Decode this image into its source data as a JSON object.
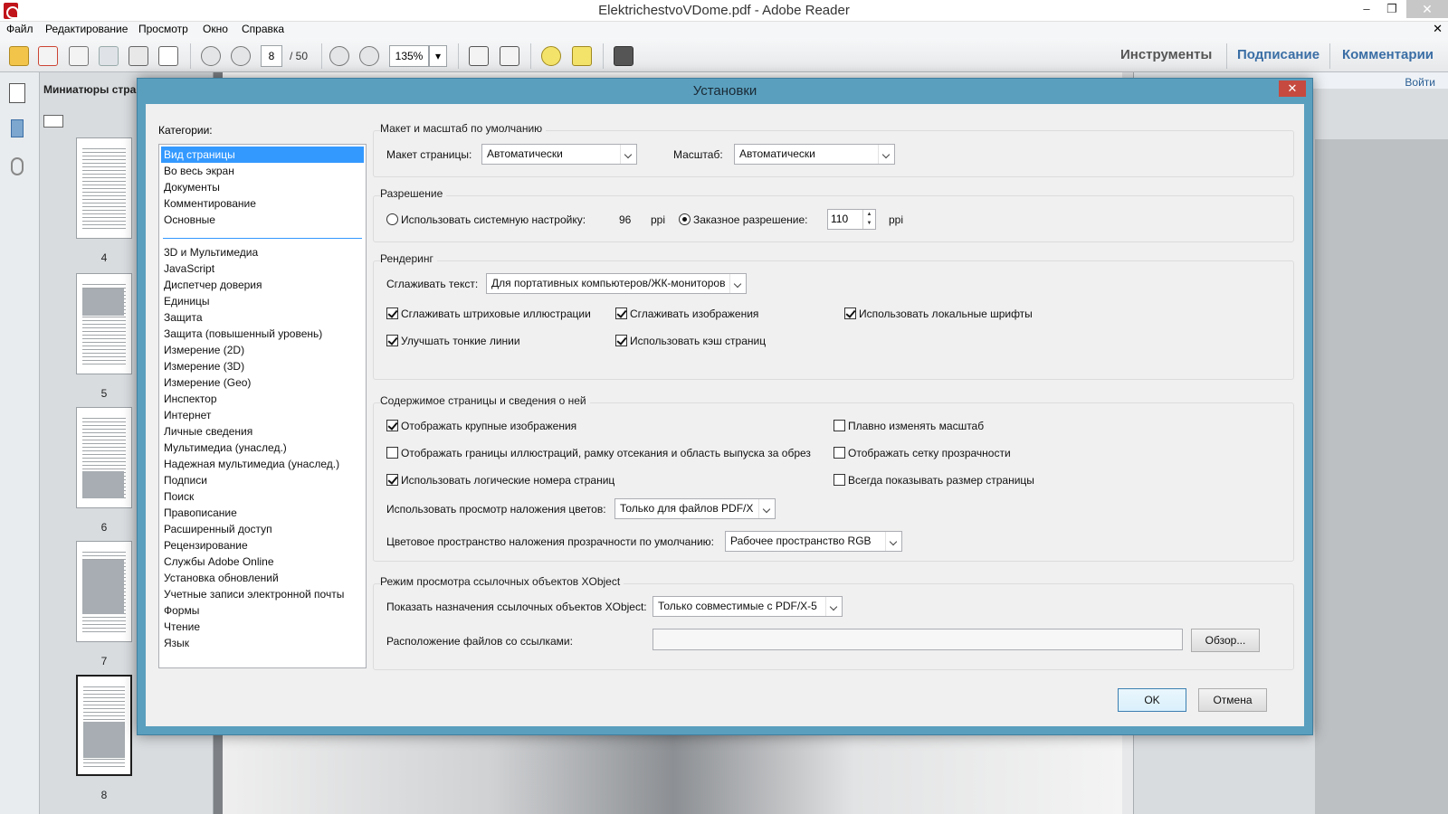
{
  "window": {
    "title": "ElektrichestvoVDome.pdf - Adobe Reader",
    "minimize": "–",
    "restore": "❐",
    "close": "✕"
  },
  "menu": {
    "items": [
      "Файл",
      "Редактирование",
      "Просмотр",
      "Окно",
      "Справка"
    ],
    "doc_close": "✕"
  },
  "toolbar": {
    "page_current": "8",
    "page_sep_total": "/ 50",
    "zoom": "135%",
    "right_tabs": [
      "Инструменты",
      "Подписание",
      "Комментарии"
    ]
  },
  "left_pane": {
    "title": "Миниатюры стра",
    "thumbnails": [
      "4",
      "5",
      "6",
      "7",
      "8"
    ]
  },
  "right_pane": {
    "login": "Войти"
  },
  "dialog": {
    "title": "Установки",
    "close": "✕",
    "categories_label": "Категории:",
    "categories_top": [
      "Вид страницы",
      "Во весь экран",
      "Документы",
      "Комментирование",
      "Основные"
    ],
    "categories_rest": [
      "3D и Мультимедиа",
      "JavaScript",
      "Диспетчер доверия",
      "Единицы",
      "Защита",
      "Защита (повышенный уровень)",
      "Измерение (2D)",
      "Измерение (3D)",
      "Измерение (Geo)",
      "Инспектор",
      "Интернет",
      "Личные сведения",
      "Мультимедиа (унаслед.)",
      "Надежная мультимедиа (унаслед.)",
      "Подписи",
      "Поиск",
      "Правописание",
      "Расширенный доступ",
      "Рецензирование",
      "Службы Adobe Online",
      "Установка обновлений",
      "Учетные записи электронной почты",
      "Формы",
      "Чтение",
      "Язык"
    ],
    "selected_category": "Вид страницы",
    "layout": {
      "group_label": "Макет и масштаб по умолчанию",
      "page_layout_label": "Макет страницы:",
      "page_layout_value": "Автоматически",
      "zoom_label": "Масштаб:",
      "zoom_value": "Автоматически"
    },
    "resolution": {
      "group_label": "Разрешение",
      "system_label": "Использовать системную настройку:",
      "system_value": "96",
      "ppi1": "ppi",
      "custom_label": "Заказное разрешение:",
      "custom_value": "110",
      "ppi2": "ppi",
      "system_selected": false,
      "custom_selected": true
    },
    "rendering": {
      "group_label": "Рендеринг",
      "smooth_text_label": "Сглаживать текст:",
      "smooth_text_value": "Для портативных компьютеров/ЖК-мониторов",
      "checkboxes": [
        {
          "label": "Сглаживать штриховые иллюстрации",
          "checked": true
        },
        {
          "label": "Сглаживать изображения",
          "checked": true
        },
        {
          "label": "Использовать локальные шрифты",
          "checked": true
        },
        {
          "label": "Улучшать тонкие линии",
          "checked": true
        },
        {
          "label": "Использовать кэш страниц",
          "checked": true
        }
      ]
    },
    "content": {
      "group_label": "Содержимое страницы и сведения о ней",
      "checkboxes": [
        {
          "label": "Отображать крупные изображения",
          "checked": true
        },
        {
          "label": "Плавно изменять масштаб",
          "checked": false
        },
        {
          "label": "Отображать границы иллюстраций, рамку отсекания и область выпуска за обрез",
          "checked": false
        },
        {
          "label": "Отображать сетку прозрачности",
          "checked": false
        },
        {
          "label": "Использовать логические номера страниц",
          "checked": true
        },
        {
          "label": "Всегда показывать размер страницы",
          "checked": false
        }
      ],
      "overprint_label": "Использовать просмотр наложения цветов:",
      "overprint_value": "Только для файлов PDF/X",
      "blend_label": "Цветовое пространство наложения прозрачности по умолчанию:",
      "blend_value": "Рабочее пространство RGB"
    },
    "xobject": {
      "group_label": "Режим просмотра ссылочных объектов XObject",
      "show_label": "Показать назначения ссылочных объектов XObject:",
      "show_value": "Только совместимые с PDF/X-5",
      "location_label": "Расположение файлов со ссылками:",
      "location_value": "",
      "browse": "Обзор..."
    },
    "ok": "OK",
    "cancel": "Отмена"
  }
}
